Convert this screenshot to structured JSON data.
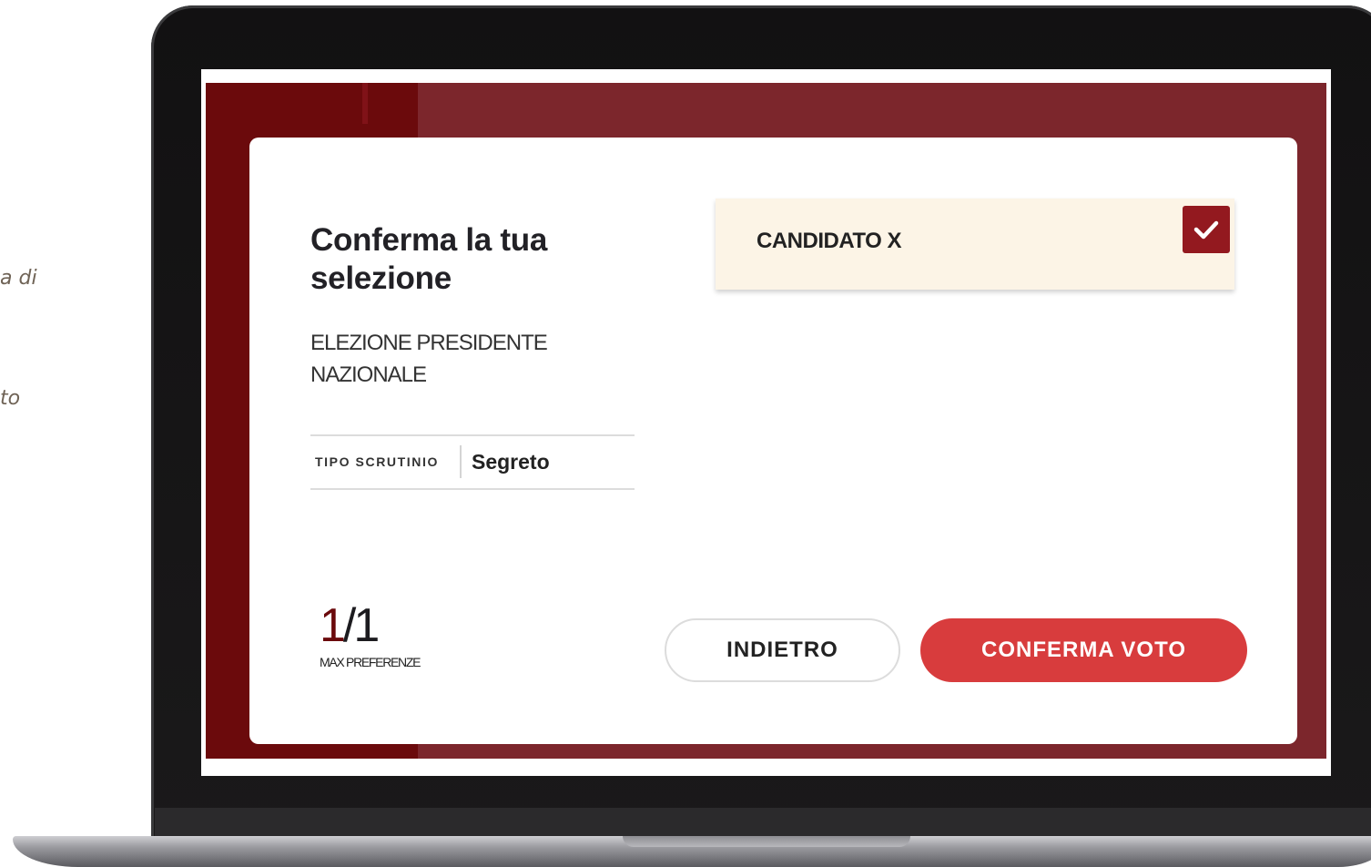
{
  "side_text": [
    "a di",
    "to"
  ],
  "screen": {
    "title": "Conferma la tua selezione",
    "election_name": "ELEZIONE PRESIDENTE NAZIONALE",
    "scrutinio": {
      "label": "TIPO SCRUTINIO",
      "value": "Segreto"
    },
    "candidate": {
      "name": "CANDIDATO X",
      "selected": true,
      "icon": "check-icon"
    },
    "preferences": {
      "current": "1",
      "separator": "/",
      "max": "1",
      "label": "MAX PREFERENZE"
    },
    "buttons": {
      "back_label": "INDIETRO",
      "confirm_label": "CONFERMA VOTO"
    }
  },
  "colors": {
    "brand_dark": "#6b0a0c",
    "brand": "#7c262c",
    "accent": "#d83c3d",
    "checkbox": "#93191f",
    "candidate_bg": "#fcf4e6"
  }
}
